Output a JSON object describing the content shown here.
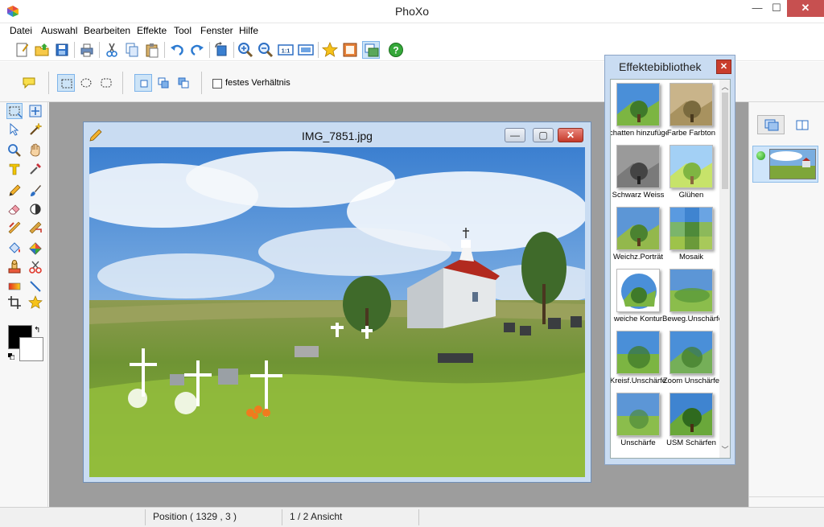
{
  "app": {
    "title": "PhoXo"
  },
  "window_controls": {
    "minimize": "—",
    "maximize": "☐",
    "close": "✕"
  },
  "menu": [
    {
      "label": "Datei"
    },
    {
      "label": "Auswahl"
    },
    {
      "label": "Bearbeiten"
    },
    {
      "label": "Effekte"
    },
    {
      "label": "Tool"
    },
    {
      "label": "Fenster"
    },
    {
      "label": "Hilfe"
    }
  ],
  "toolbar": {
    "icons": [
      "new-icon",
      "open-icon",
      "save-icon",
      "print-icon",
      "cut-icon",
      "copy-icon",
      "paste-icon",
      "undo-icon",
      "redo-icon",
      "rotate-icon",
      "zoom-in-icon",
      "zoom-out-icon",
      "actual-size-icon",
      "fit-window-icon",
      "favorite-icon",
      "frame-icon",
      "layers-icon",
      "help-icon"
    ]
  },
  "options": {
    "keep_ratio_label": "festes Verhältnis",
    "keep_ratio_checked": false
  },
  "image_window": {
    "title": "IMG_7851.jpg",
    "min": "—",
    "max": "▢",
    "close": "✕"
  },
  "effects_library": {
    "title": "Effektebibliothek",
    "close": "✕",
    "scroll_up": "︿",
    "scroll_down": "﹀",
    "items": [
      {
        "label": "chatten hinzufüge"
      },
      {
        "label": "Farbe Farbton"
      },
      {
        "label": "Schwarz Weiss"
      },
      {
        "label": "Glühen"
      },
      {
        "label": "Weichz.Porträt"
      },
      {
        "label": "Mosaik"
      },
      {
        "label": "weiche Kontur"
      },
      {
        "label": "Beweg.Unschärfe"
      },
      {
        "label": "Kreisf.Unschärfe"
      },
      {
        "label": "Zoom Unschärfe"
      },
      {
        "label": "Unschärfe"
      },
      {
        "label": "USM Schärfen"
      }
    ]
  },
  "colors": {
    "foreground": "#000000",
    "background": "#ffffff",
    "swap_glyph": "↰"
  },
  "status": {
    "position": "Position ( 1329 , 3 )",
    "view": "1 / 2 Ansicht"
  }
}
